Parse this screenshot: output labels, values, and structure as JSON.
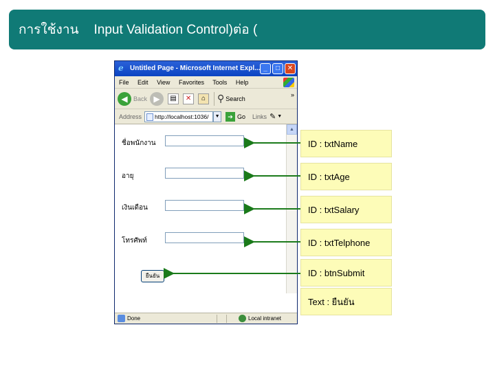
{
  "slide": {
    "title_thai": "การใช้งาน",
    "title_rest": "Input Validation Control)ต่อ  ("
  },
  "browser": {
    "window_title": "Untitled Page - Microsoft Internet Expl...",
    "menu": [
      "File",
      "Edit",
      "View",
      "Favorites",
      "Tools",
      "Help"
    ],
    "toolbar": {
      "back_label": "Back",
      "search_label": "Search",
      "more": "»"
    },
    "address": {
      "label": "Address",
      "value": "http://localhost:1036/",
      "go_label": "Go",
      "links_label": "Links",
      "more": "»"
    },
    "status": {
      "done_label": "Done",
      "zone_label": "Local intranet"
    }
  },
  "form": {
    "fields": [
      {
        "label": "ชื่อพนักงาน"
      },
      {
        "label": "อายุ"
      },
      {
        "label": "เงินเดือน"
      },
      {
        "label": "โทรศัพท์"
      }
    ],
    "submit_label": "ยืนยัน"
  },
  "annotations": [
    {
      "text": "ID : txtName"
    },
    {
      "text": "ID : txtAge"
    },
    {
      "text": "ID : txtSalary"
    },
    {
      "text": "ID : txtTelphone"
    },
    {
      "text": "ID : btnSubmit"
    },
    {
      "text": "Text : ยืนยัน"
    }
  ],
  "colors": {
    "title_bg": "#107a76",
    "annotation_bg": "#fdfcb8",
    "arrow": "#1a7a1a"
  }
}
